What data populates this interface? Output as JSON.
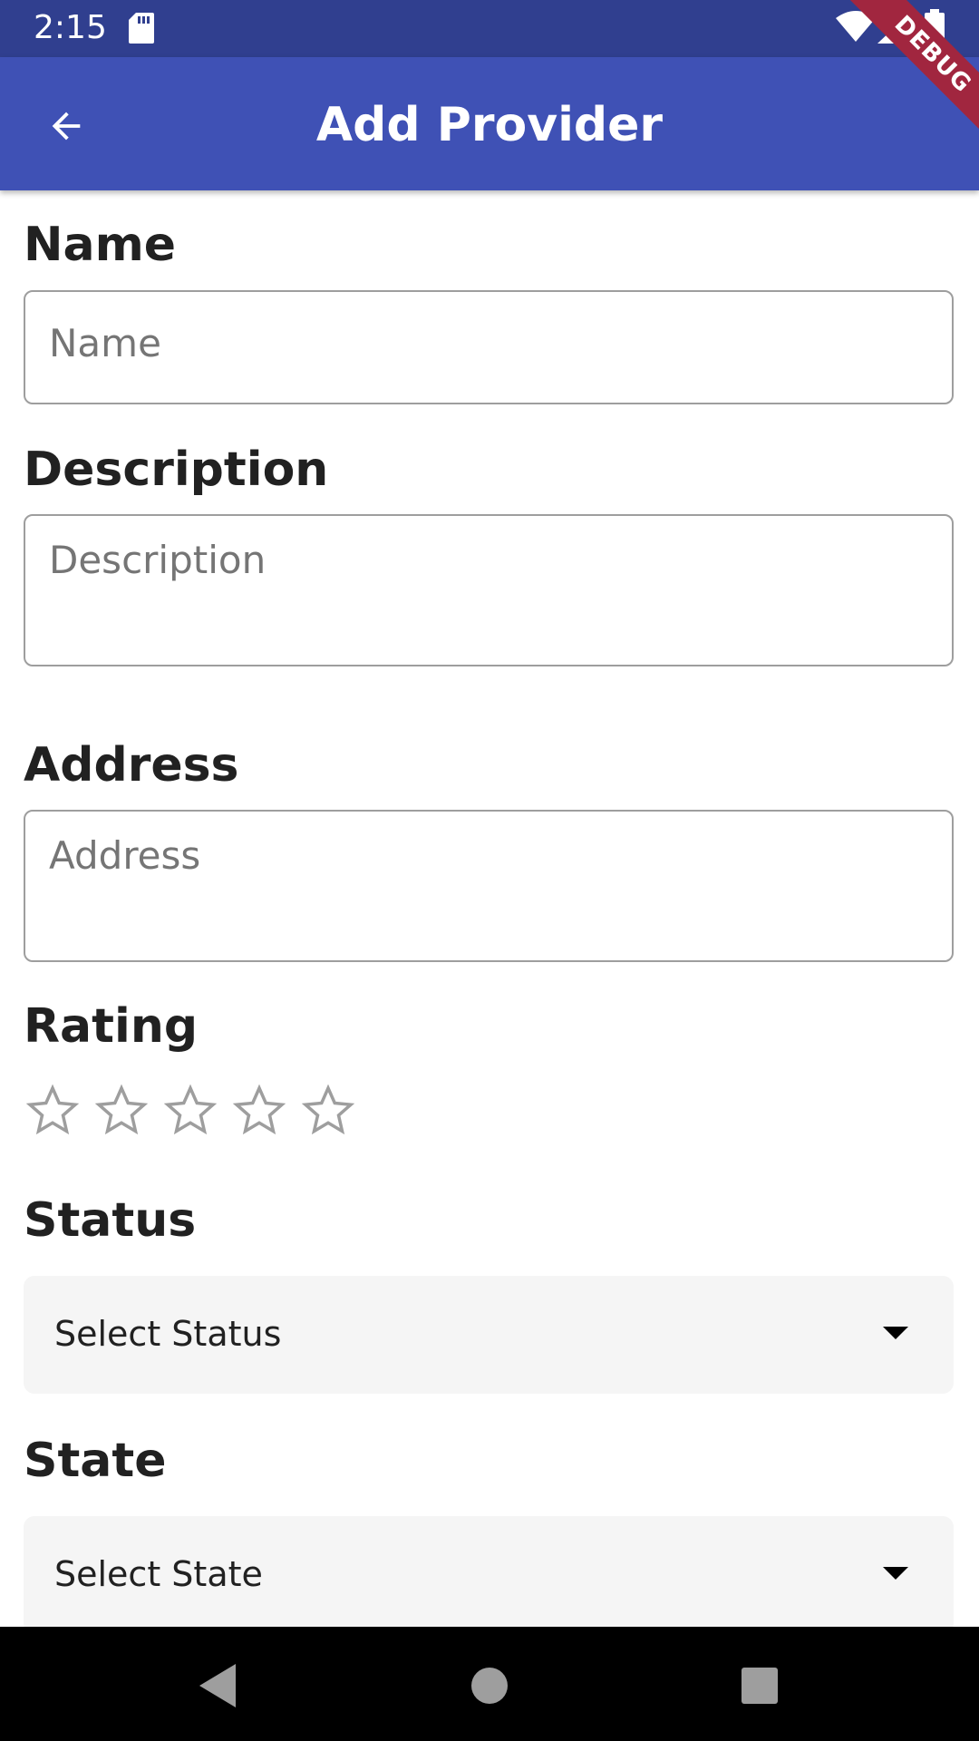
{
  "status_bar": {
    "time": "2:15",
    "icons": [
      "sd-card-icon",
      "wifi-icon",
      "cell-signal-icon",
      "battery-icon"
    ]
  },
  "app_bar": {
    "title": "Add Provider",
    "back_icon": "arrow-back-icon",
    "background": "#3f51b5"
  },
  "debug_banner": {
    "label": "DEBUG"
  },
  "form": {
    "name": {
      "label": "Name",
      "placeholder": "Name",
      "value": ""
    },
    "description": {
      "label": "Description",
      "placeholder": "Description",
      "value": ""
    },
    "address": {
      "label": "Address",
      "placeholder": "Address",
      "value": ""
    },
    "rating": {
      "label": "Rating",
      "value": 0,
      "max": 5,
      "star_icon": "star-outline-icon"
    },
    "status": {
      "label": "Status",
      "selected": "Select Status"
    },
    "state": {
      "label": "State",
      "selected": "Select State"
    }
  },
  "nav_bar": {
    "icons": [
      "back-triangle-icon",
      "home-circle-icon",
      "recents-square-icon"
    ]
  },
  "colors": {
    "primary": "#3f51b5",
    "status_bar": "#303f8f",
    "debug": "#a1263f",
    "dropdown_bg": "#f5f5f5",
    "star_outline": "#9e9e9e"
  }
}
